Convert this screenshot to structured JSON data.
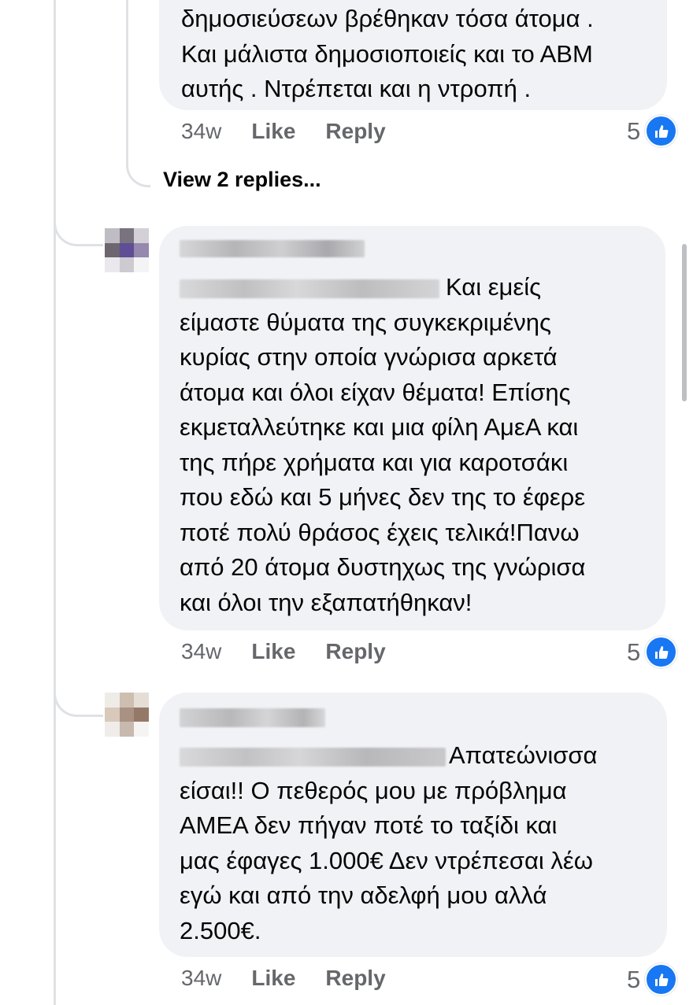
{
  "comments": [
    {
      "text": "δημοσιεύσεων βρέθηκαν τόσα άτομα .\nΚαι μάλιστα δημοσιοποιείς και το ΑΒΜ\nαυτής . Ντρέπεται και η ντροπή .",
      "time": "34w",
      "like": "Like",
      "reply": "Reply",
      "reactions": "5"
    },
    {
      "text": "Και εμείς\nείμαστε θύματα της συγκεκριμένης\nκυρίας στην οποία γνώρισα αρκετά\nάτομα και όλοι είχαν θέματα! Επίσης\nεκμεταλλεύτηκε και μια φίλη ΑμεΑ και\nτης πήρε χρήματα και για καροτσάκι\nπου εδώ και 5 μήνες δεν της το έφερε\nποτέ πολύ θράσος έχεις τελικά!Πανω\nαπό 20 άτομα δυστηχως της γνώρισα\nκαι όλοι την εξαπατήθηκαν!",
      "time": "34w",
      "like": "Like",
      "reply": "Reply",
      "reactions": "5"
    },
    {
      "text": "Απατεώνισσα\nείσαι!! Ο πεθερός μου με πρόβλημα\nΑΜΕΑ δεν πήγαν ποτέ το ταξίδι και\nμας έφαγες 1.000€ Δεν ντρέπεσαι λέω\nεγώ και από την αδελφή μου αλλά\n2.500€.",
      "time": "34w",
      "like": "Like",
      "reply": "Reply",
      "reactions": "5"
    }
  ],
  "view_replies": "View 2 replies...",
  "colors": {
    "bubble": "#f0f2f5",
    "meta": "#65676b",
    "like_blue": "#1877f2",
    "thread": "#dfe1e5"
  },
  "icons": {
    "reaction": "like-thumb-icon"
  }
}
